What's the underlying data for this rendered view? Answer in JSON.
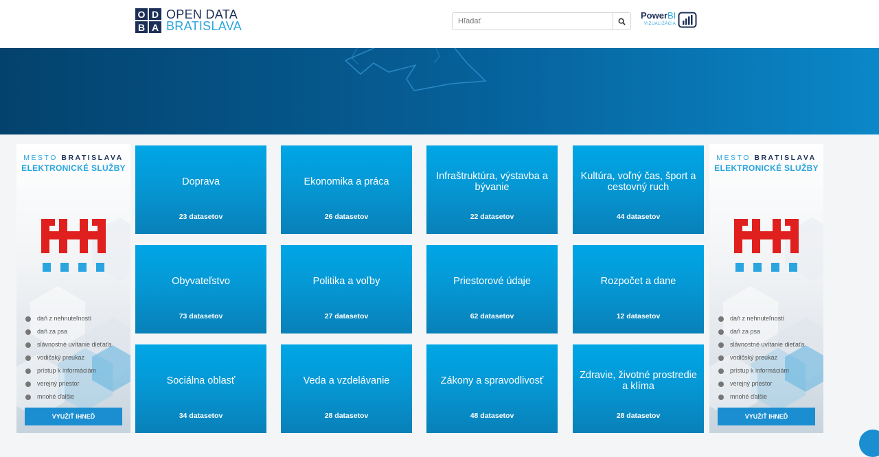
{
  "header": {
    "logo_letters": [
      "O",
      "D",
      "B",
      "A"
    ],
    "logo_line1": "OPEN DATA",
    "logo_line2": "BRATISLAVA",
    "search_placeholder": "Hľadať",
    "powerbi_main_a": "Power",
    "powerbi_main_b": "BI",
    "powerbi_sub": "VIZUALIZÁCIA"
  },
  "categories": [
    {
      "name": "Doprava",
      "count": "23 datasetov"
    },
    {
      "name": "Ekonomika a práca",
      "count": "26 datasetov"
    },
    {
      "name": "Infraštruktúra, výstavba a bývanie",
      "count": "22 datasetov"
    },
    {
      "name": "Kultúra, voľný čas, šport a cestovný ruch",
      "count": "44 datasetov"
    },
    {
      "name": "Obyvateľstvo",
      "count": "73 datasetov"
    },
    {
      "name": "Politika a voľby",
      "count": "27 datasetov"
    },
    {
      "name": "Priestorové údaje",
      "count": "62 datasetov"
    },
    {
      "name": "Rozpočet a dane",
      "count": "12 datasetov"
    },
    {
      "name": "Sociálna oblasť",
      "count": "34 datasetov"
    },
    {
      "name": "Veda a vzdelávanie",
      "count": "28 datasetov"
    },
    {
      "name": "Zákony a spravodlivosť",
      "count": "48 datasetov"
    },
    {
      "name": "Zdravie, životné prostredie a klíma",
      "count": "28 datasetov"
    }
  ],
  "ad": {
    "line1_a": "MESTO",
    "line1_b": "BRATISLAVA",
    "line2": "ELEKTRONICKÉ SLUŽBY",
    "services": [
      "daň z nehnuteľností",
      "daň za psa",
      "slávnostné uvítanie dieťaťa",
      "vodičský preukaz",
      "prístup k informáciám",
      "verejný priestor",
      "mnohé ďalšie"
    ],
    "button": "VYUŽIŤ IHNEĎ"
  },
  "colors": {
    "brand_dark": "#1c2f57",
    "brand_blue": "#2aa5e0",
    "tile_top": "#00a6e6",
    "tile_bottom": "#0980b8",
    "ad_red": "#e0201e"
  }
}
